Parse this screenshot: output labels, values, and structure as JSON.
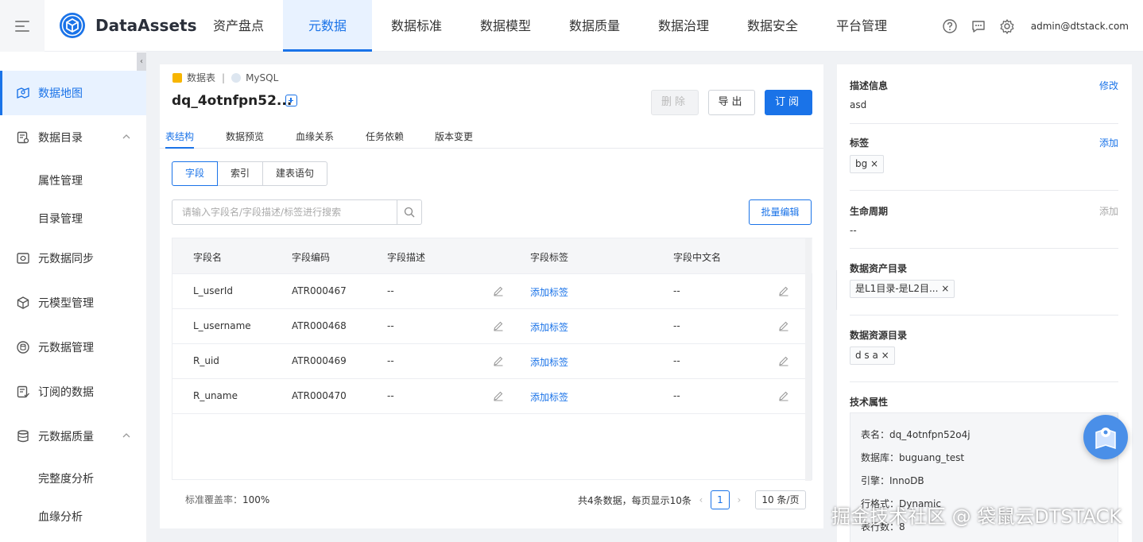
{
  "app": {
    "name": "DataAssets"
  },
  "nav": [
    "资产盘点",
    "元数据",
    "数据标准",
    "数据模型",
    "数据质量",
    "数据治理",
    "数据安全",
    "平台管理"
  ],
  "user": "admin@dtstack.com",
  "sidebar": {
    "items": [
      "数据地图",
      "数据目录",
      "元数据同步",
      "元模型管理",
      "元数据管理",
      "订阅的数据",
      "元数据质量"
    ],
    "subitems": [
      "属性管理",
      "目录管理",
      "完整度分析",
      "血缘分析"
    ]
  },
  "detail": {
    "breadcrumb_type": "数据表",
    "breadcrumb_source": "MySQL",
    "title": "dq_4otnfpn52...",
    "buttons": {
      "delete": "删除",
      "export": "导出",
      "subscribe": "订阅"
    },
    "tabs": [
      "表结构",
      "数据预览",
      "血缘关系",
      "任务依赖",
      "版本变更"
    ],
    "segments": [
      "字段",
      "索引",
      "建表语句"
    ],
    "search_placeholder": "请输入字段名/字段描述/标签进行搜索",
    "batch_edit": "批量编辑",
    "columns": [
      "字段名",
      "字段编码",
      "字段描述",
      "字段标签",
      "字段中文名"
    ],
    "rows": [
      {
        "name": "L_userId",
        "code": "ATR000467",
        "desc": "--",
        "tag": "添加标签",
        "cn": "--"
      },
      {
        "name": "L_username",
        "code": "ATR000468",
        "desc": "--",
        "tag": "添加标签",
        "cn": "--"
      },
      {
        "name": "R_uid",
        "code": "ATR000469",
        "desc": "--",
        "tag": "添加标签",
        "cn": "--"
      },
      {
        "name": "R_uname",
        "code": "ATR000470",
        "desc": "--",
        "tag": "添加标签",
        "cn": "--"
      }
    ],
    "coverage_label": "标准覆盖率：",
    "coverage_value": "100%",
    "pager_summary": "共4条数据，每页显示10条",
    "pager_current": "1",
    "pager_size": "10 条/页"
  },
  "right": {
    "desc_title": "描述信息",
    "desc_action": "修改",
    "desc_value": "asd",
    "tag_title": "标签",
    "tag_action": "添加",
    "tag_value": "bg",
    "lifecycle_title": "生命周期",
    "lifecycle_action": "添加",
    "lifecycle_value": "--",
    "asset_dir_title": "数据资产目录",
    "asset_dir_value": "是L1目录-是L2目...",
    "resource_dir_title": "数据资源目录",
    "resource_dir_value": "d s a",
    "tech_title": "技术属性",
    "tech": [
      "表名：dq_4otnfpn52o4j",
      "数据库：buguang_test",
      "引擎：InnoDB",
      "行格式：Dynamic",
      "表行数：8"
    ]
  },
  "watermark": "掘金技术社区 @ 袋鼠云DTSTACK",
  "colors": {
    "accent": "#1a73e8",
    "active_bg": "#e8f2ff"
  }
}
